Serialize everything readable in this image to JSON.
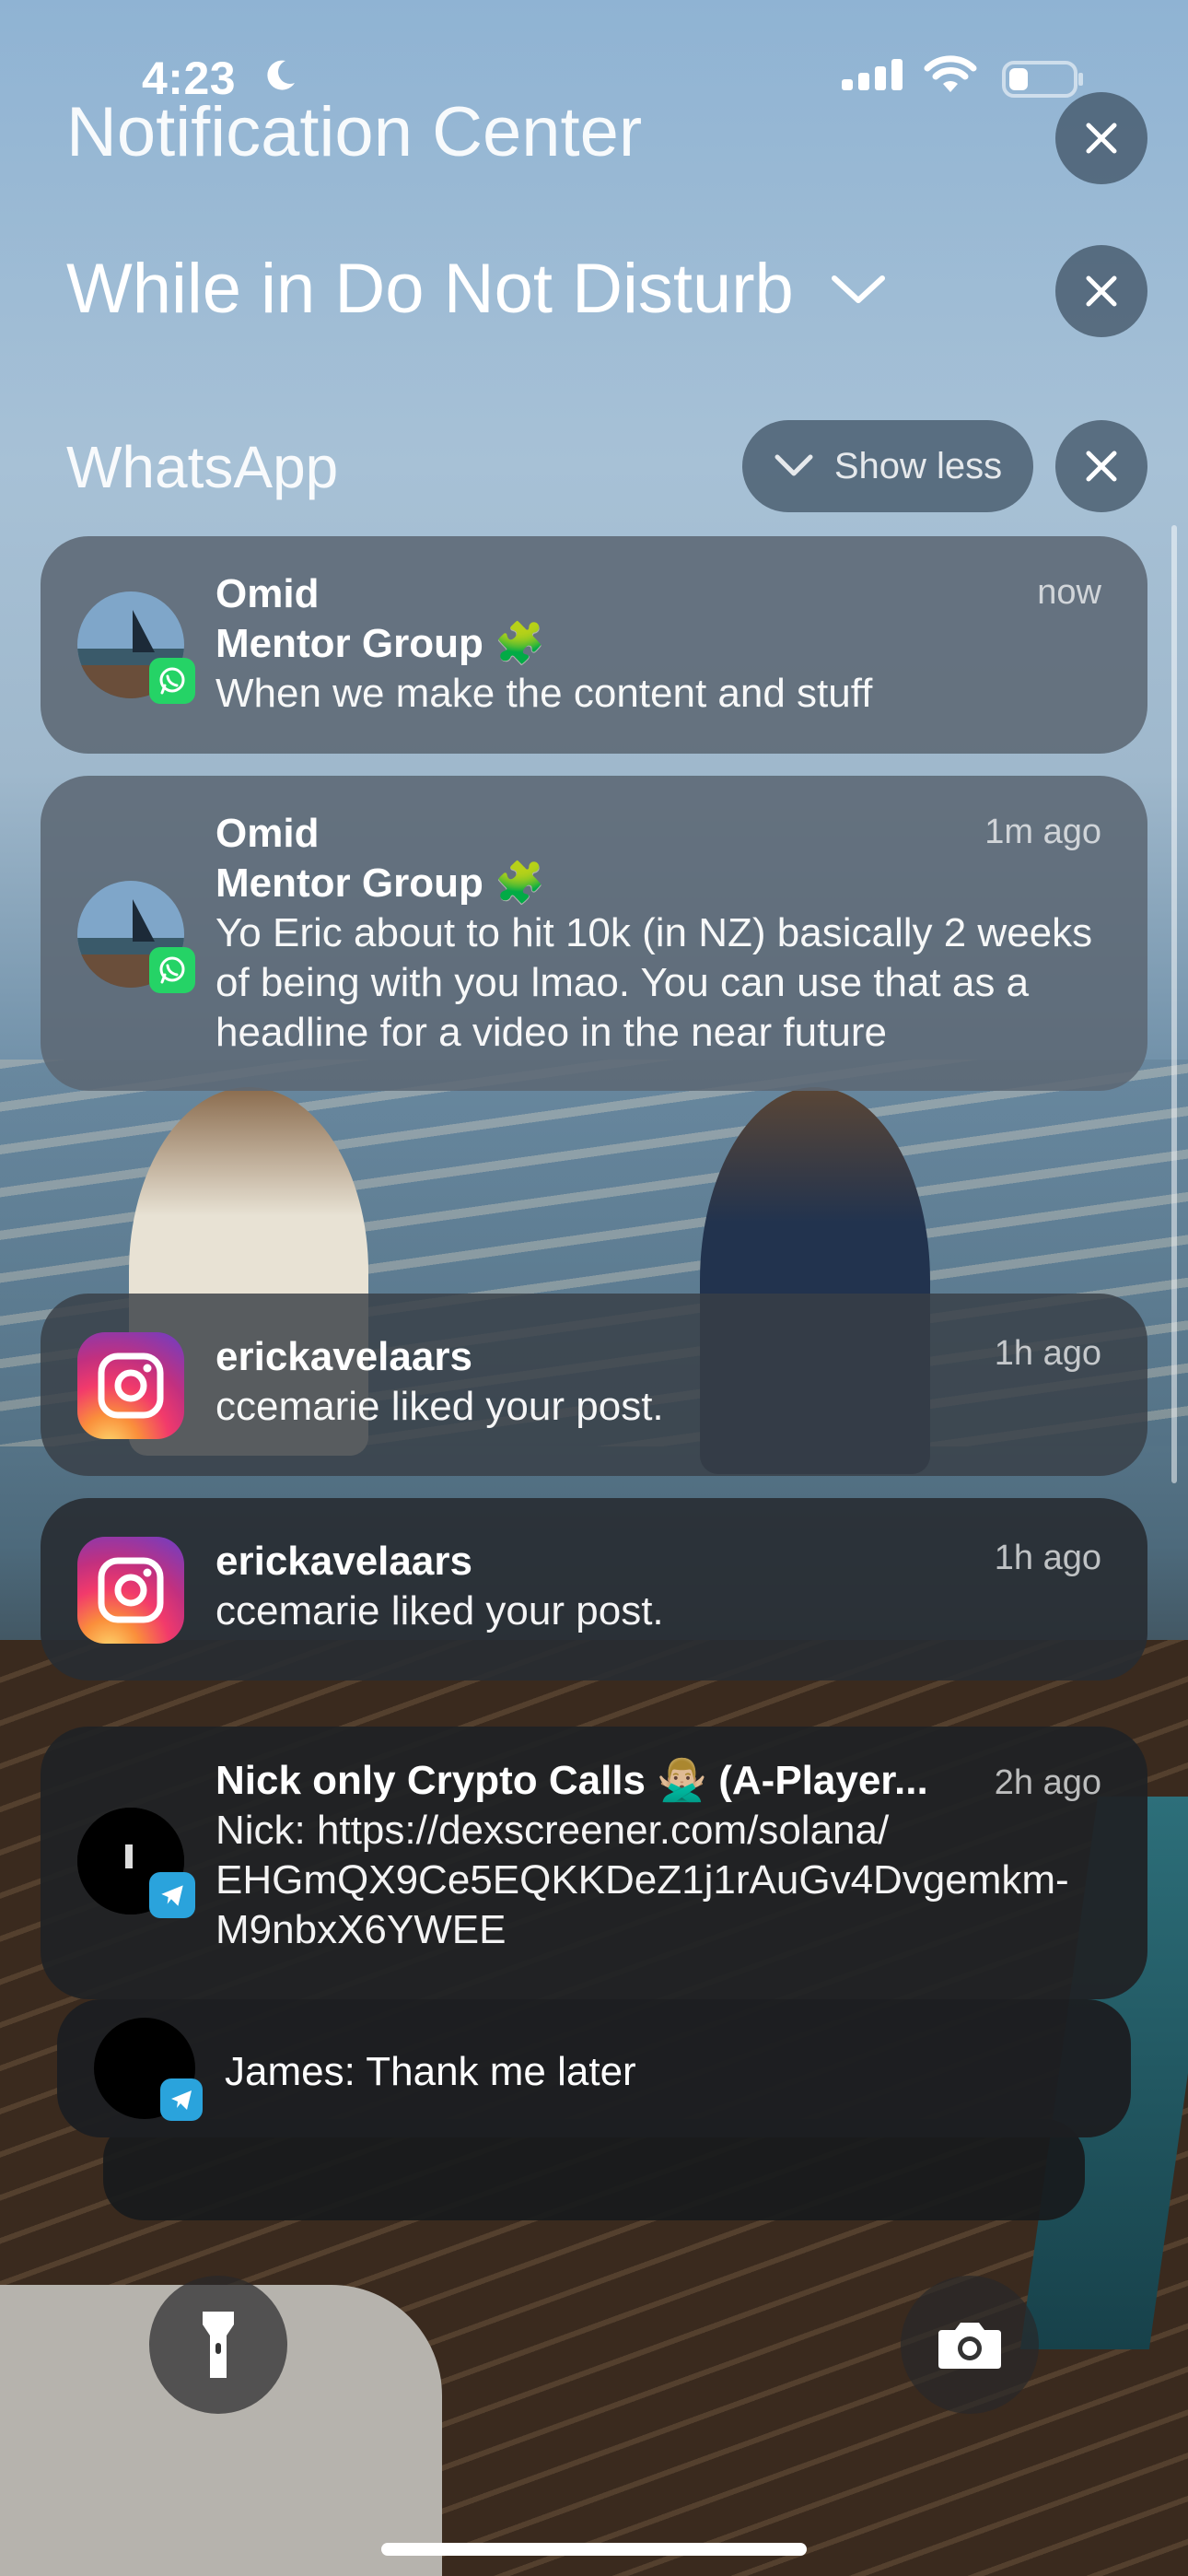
{
  "status_bar": {
    "time": "4:23",
    "focus_icon": "moon-icon",
    "signal_icon": "cellular-signal-icon",
    "wifi_icon": "wifi-icon",
    "battery_icon": "battery-icon",
    "battery_level": 0.3
  },
  "header": {
    "title": "Notification Center",
    "focus_label": "While in Do Not Disturb"
  },
  "group": {
    "app_name": "WhatsApp",
    "show_less_label": "Show less"
  },
  "notifications": [
    {
      "app": "WhatsApp",
      "sender": "Omid",
      "group": "Mentor Group 🧩",
      "message": "When we make the content and stuff",
      "time": "now"
    },
    {
      "app": "WhatsApp",
      "sender": "Omid",
      "group": "Mentor Group 🧩",
      "message": "Yo Eric about to hit 10k (in NZ) basically 2 weeks of being with you lmao. You can use that as a headline for a video in the near future",
      "time": "1m ago"
    },
    {
      "app": "Instagram",
      "sender": "erickavelaars",
      "message": "ccemarie liked your post.",
      "time": "1h ago"
    },
    {
      "app": "Instagram",
      "sender": "erickavelaars",
      "message": "ccemarie liked your post.",
      "time": "1h ago"
    },
    {
      "app": "Telegram",
      "sender": "Nick only Crypto Calls 🙅🏼‍♂️ (A-Player...",
      "message": "Nick: https://dexscreener.com/solana/EHGmQX9Ce5EQKKDeZ1j1rAuGv4Dvgemkm-M9nbxX6YWEE",
      "message_lines": [
        "Nick: https://dexscreener.com/solana/",
        "EHGmQX9Ce5EQKKDeZ1j1rAuGv4Dvgemkm-",
        "M9nbxX6YWEE"
      ],
      "time": "2h ago"
    },
    {
      "app": "Telegram",
      "message": "James: Thank me later"
    }
  ],
  "controls": {
    "flashlight_icon": "flashlight-icon",
    "camera_icon": "camera-icon"
  },
  "colors": {
    "card_gray": "#5c6874",
    "card_dark": "#202225",
    "whatsapp_green": "#25d366",
    "telegram_blue": "#2aa3dc"
  }
}
